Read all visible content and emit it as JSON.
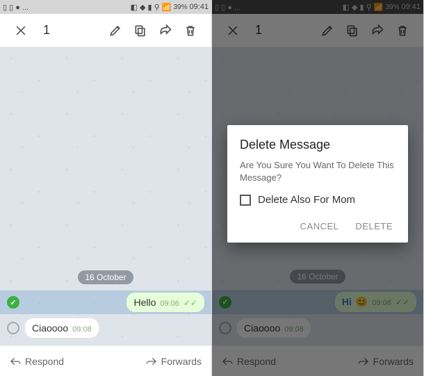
{
  "status": {
    "battery_percent": "39%",
    "time": "09:41",
    "left_icons": "▯ ▯ ● ...",
    "right_icons": "◧ ◆ ▮ ⚲ 📶"
  },
  "actionbar": {
    "selected_count": "1"
  },
  "chat": {
    "date_chip": "16 October",
    "left": {
      "msg_out": {
        "text": "Hello",
        "time": "09:06"
      },
      "msg_in": {
        "text": "Ciaoooo",
        "time": "09:08"
      }
    },
    "right": {
      "msg_out": {
        "text": "Hi",
        "emoji": "😊",
        "time": "09:06"
      },
      "msg_in": {
        "text": "Ciaoooo",
        "time": "09:08"
      }
    }
  },
  "bottombar": {
    "respond": "Respond",
    "forwards": "Forwards"
  },
  "dialog": {
    "title": "Delete Message",
    "body": "Are You Sure You Want To Delete This Message?",
    "checkbox_label": "Delete Also For Mom",
    "cancel": "CANCEL",
    "delete": "DELETE"
  }
}
